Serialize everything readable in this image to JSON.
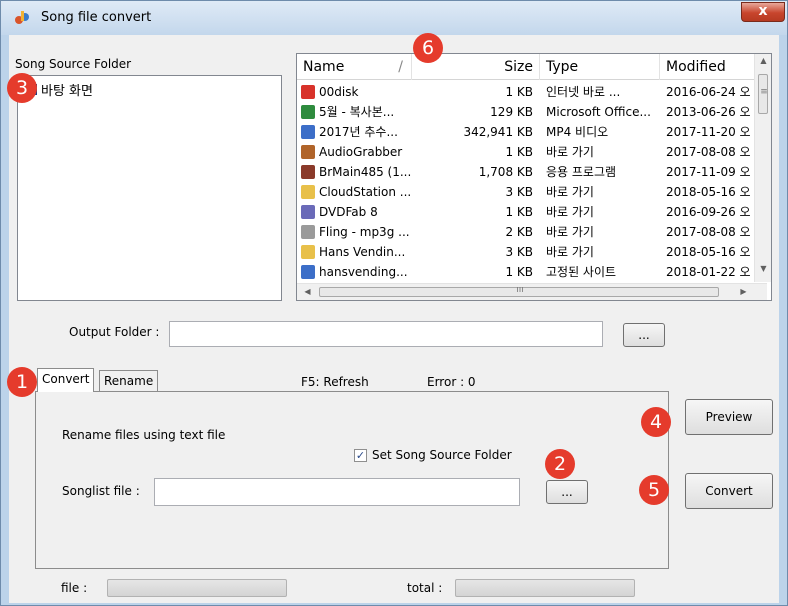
{
  "window": {
    "title": "Song file convert",
    "close_glyph": "x"
  },
  "source_folder": {
    "label": "Song Source Folder",
    "tree_item": "바탕 화면"
  },
  "file_list": {
    "columns": {
      "name": "Name",
      "size": "Size",
      "type": "Type",
      "modified": "Modified"
    },
    "rows": [
      {
        "name": "00disk",
        "size": "1 KB",
        "type": "인터넷 바로 ...",
        "modified": "2016-06-24 오",
        "icon": "red-dot-icon",
        "color": "#d8322a"
      },
      {
        "name": "5월 - 복사본...",
        "size": "129 KB",
        "type": "Microsoft Office...",
        "modified": "2013-06-26 오",
        "icon": "spreadsheet-icon",
        "color": "#2e8b3e"
      },
      {
        "name": "2017년 추수...",
        "size": "342,941 KB",
        "type": "MP4 비디오",
        "modified": "2017-11-20 오",
        "icon": "video-icon",
        "color": "#3c6ec8"
      },
      {
        "name": "AudioGrabber",
        "size": "1 KB",
        "type": "바로 가기",
        "modified": "2017-08-08 오",
        "icon": "audio-grabber-icon",
        "color": "#b0642a"
      },
      {
        "name": "BrMain485 (1...",
        "size": "1,708 KB",
        "type": "응용 프로그램",
        "modified": "2017-11-09 오",
        "icon": "app-icon",
        "color": "#8a3a2a"
      },
      {
        "name": "CloudStation ...",
        "size": "3 KB",
        "type": "바로 가기",
        "modified": "2018-05-16 오",
        "icon": "folder-icon",
        "color": "#e8c04a"
      },
      {
        "name": "DVDFab 8",
        "size": "1 KB",
        "type": "바로 가기",
        "modified": "2016-09-26 오",
        "icon": "dvd-icon",
        "color": "#6a6ab8"
      },
      {
        "name": "Fling - mp3g ...",
        "size": "2 KB",
        "type": "바로 가기",
        "modified": "2017-08-08 오",
        "icon": "shortcut-icon",
        "color": "#9a9a9a"
      },
      {
        "name": "Hans Vendin...",
        "size": "3 KB",
        "type": "바로 가기",
        "modified": "2018-05-16 오",
        "icon": "folder-icon",
        "color": "#e8c04a"
      },
      {
        "name": "hansvending...",
        "size": "1 KB",
        "type": "고정된 사이트",
        "modified": "2018-01-22 오",
        "icon": "site-icon",
        "color": "#3c6ec8"
      }
    ]
  },
  "output": {
    "label": "Output Folder :",
    "value": "",
    "browse": "..."
  },
  "tabs": [
    {
      "label": "Convert"
    },
    {
      "label": "Rename"
    }
  ],
  "status": {
    "refresh": "F5: Refresh",
    "error": "Error : 0"
  },
  "convert_tab": {
    "description": "Rename files using text file",
    "checkbox_label": "Set Song Source Folder",
    "checked_glyph": "✓",
    "songlist_label": "Songlist file :",
    "songlist_value": "",
    "browse": "..."
  },
  "actions": {
    "preview": "Preview",
    "convert": "Convert"
  },
  "progress": {
    "file_label": "file :",
    "total_label": "total :"
  },
  "badges": [
    "1",
    "2",
    "3",
    "4",
    "5",
    "6"
  ],
  "scroll_glyphs": {
    "up": "▲",
    "down": "▼",
    "left": "◀",
    "right": "▶",
    "thumb_h": "ııı",
    "thumb_v": "≡"
  }
}
